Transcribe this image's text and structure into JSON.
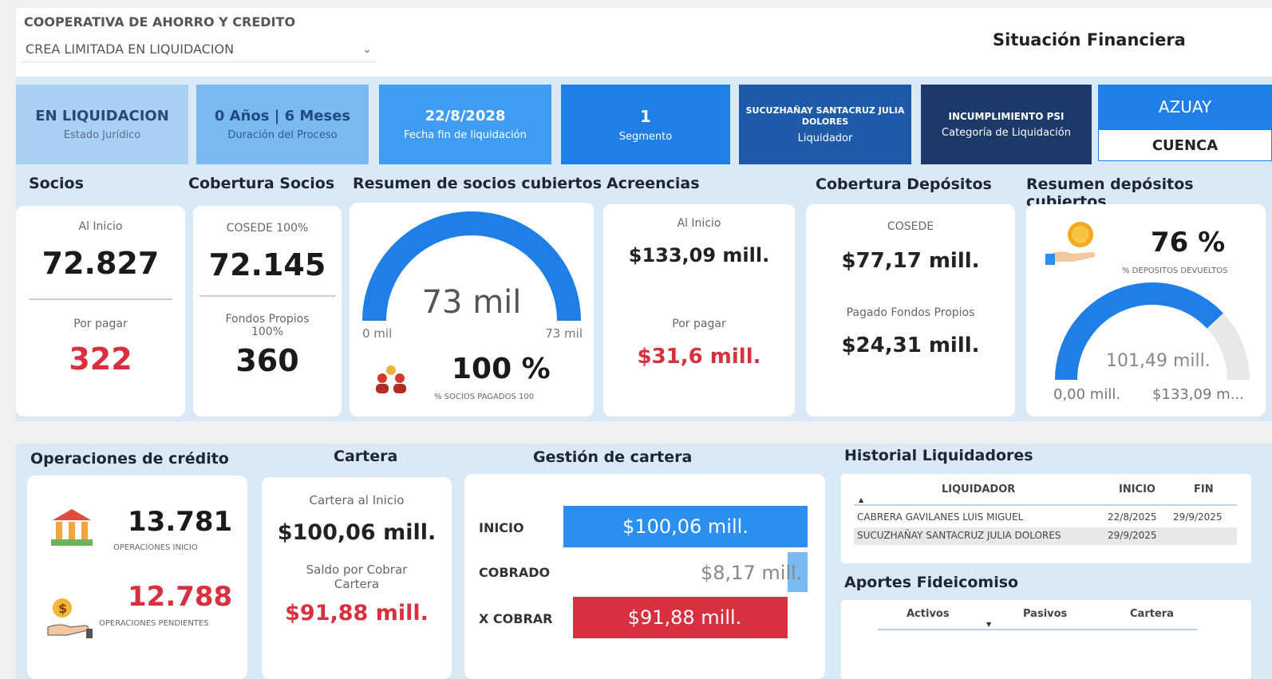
{
  "header": {
    "coop_label": "COOPERATIVA DE AHORRO Y CREDITO",
    "coop_select": "CREA LIMITADA EN LIQUIDACION",
    "page_title": "Situación Financiera"
  },
  "kpis": {
    "estado": {
      "value": "EN LIQUIDACION",
      "caption": "Estado Jurídico"
    },
    "duracion": {
      "value": "0 Años | 6 Meses",
      "caption": "Duración del Proceso"
    },
    "fecha": {
      "value": "22/8/2028",
      "caption": "Fecha fin de liquidación"
    },
    "segmento": {
      "value": "1",
      "caption": "Segmento"
    },
    "liquidador": {
      "value": "SUCUZHAÑAY SANTACRUZ JULIA DOLORES",
      "caption": "Liquidador"
    },
    "categoria": {
      "value": "INCUMPLIMIENTO PSI",
      "caption": "Categoría de Liquidación"
    },
    "provincia": "AZUAY",
    "ciudad": "CUENCA"
  },
  "sections": {
    "socios": "Socios",
    "cobertura_socios": "Cobertura Socios",
    "resumen_socios": "Resumen de socios cubiertos",
    "acreencias": "Acreencias",
    "cobertura_depositos": "Cobertura Depósitos",
    "resumen_depositos": "Resumen depósitos cubiertos",
    "operaciones": "Operaciones de crédito",
    "cartera": "Cartera",
    "gestion": "Gestión de cartera",
    "historial": "Historial Liquidadores",
    "aportes": "Aportes Fideicomiso"
  },
  "socios": {
    "inicio_label": "Al Inicio",
    "inicio_value": "72.827",
    "pagar_label": "Por pagar",
    "pagar_value": "322"
  },
  "cobertura_socios": {
    "cosede_label": "COSEDE 100%",
    "cosede_value": "72.145",
    "propios_label": "Fondos Propios 100%",
    "propios_value": "360"
  },
  "gauge_socios": {
    "center": "73 mil",
    "min": "0 mil",
    "max": "73 mil",
    "percent": "100 %",
    "percent_label": "% SOCIOS PAGADOS 100",
    "fraction": 1.0
  },
  "acreencias": {
    "inicio_label": "Al Inicio",
    "inicio_value": "$133,09 mill.",
    "pagar_label": "Por pagar",
    "pagar_value": "$31,6 mill."
  },
  "cobertura_depositos": {
    "cosede_label": "COSEDE",
    "cosede_value": "$77,17 mill.",
    "propios_label": "Pagado Fondos Propios",
    "propios_value": "$24,31 mill."
  },
  "gauge_depositos": {
    "percent": "76 %",
    "percent_label": "% DEPOSITOS DEVUELTOS",
    "center": "101,49 mill.",
    "min": "0,00 mill.",
    "max": "$133,09 m...",
    "fraction": 0.76
  },
  "operaciones": {
    "inicio_value": "13.781",
    "inicio_label": "OPERACIONES INICIO",
    "pend_value": "12.788",
    "pend_label": "OPERACIONES PENDIENTES"
  },
  "cartera": {
    "inicio_label": "Cartera al Inicio",
    "inicio_value": "$100,06 mill.",
    "saldo_label": "Saldo por Cobrar Cartera",
    "saldo_value": "$91,88 mill."
  },
  "gestion": {
    "rows": [
      {
        "label": "INICIO",
        "value": "$100,06 mill.",
        "amount": 100.06
      },
      {
        "label": "COBRADO",
        "value": "$8,17 mill.",
        "amount": 8.17
      },
      {
        "label": "X COBRAR",
        "value": "$91,88 mill.",
        "amount": 91.88
      }
    ]
  },
  "historial": {
    "headers": [
      "LIQUIDADOR",
      "INICIO",
      "FIN"
    ],
    "rows": [
      [
        "CABRERA GAVILANES LUIS MIGUEL",
        "22/8/2025",
        "29/9/2025"
      ],
      [
        "SUCUZHAÑAY SANTACRUZ JULIA DOLORES",
        "29/9/2025",
        ""
      ]
    ]
  },
  "aportes": {
    "headers": [
      "Activos",
      "Pasivos",
      "Cartera"
    ]
  },
  "colors": {
    "blue": "#2a8ff0",
    "red": "#d8303e",
    "navy": "#1b3f7a",
    "lightblue": "#a8d1f5"
  }
}
